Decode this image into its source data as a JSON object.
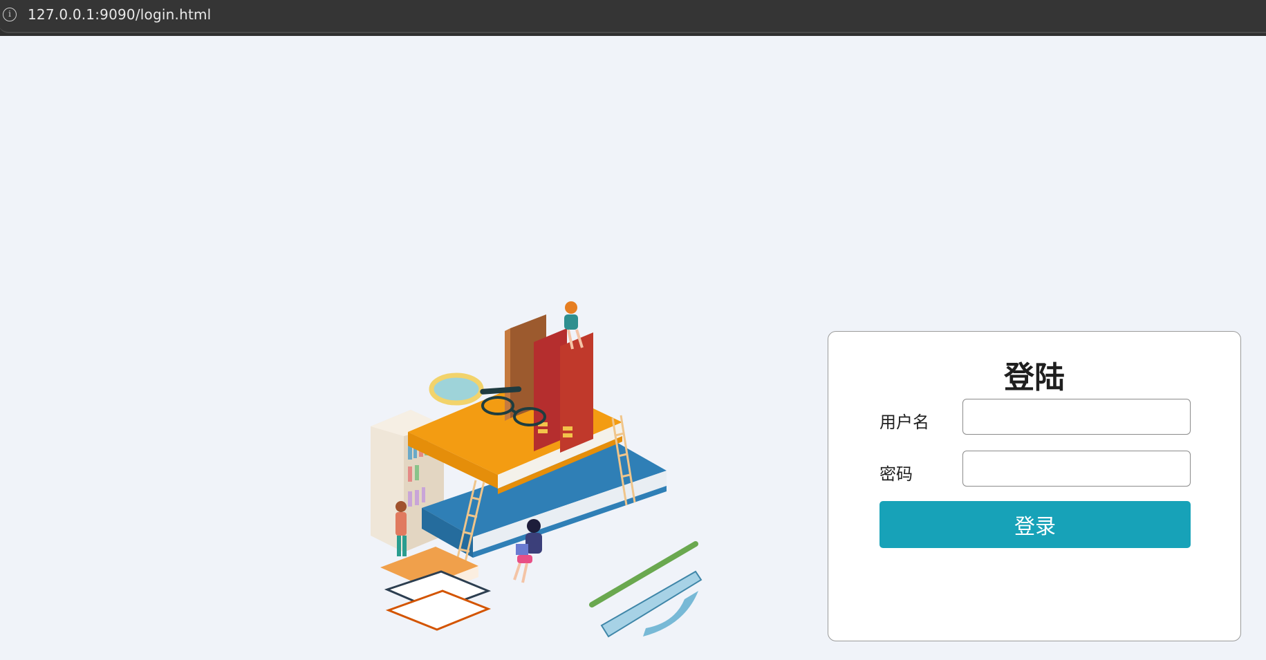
{
  "browser": {
    "url": "127.0.0.1:9090/login.html",
    "info_icon": "info-icon"
  },
  "login": {
    "title": "登陆",
    "username_label": "用户名",
    "username_value": "",
    "password_label": "密码",
    "password_value": "",
    "submit_label": "登录",
    "submit_color": "#17a2b8"
  },
  "illustration": {
    "name": "isometric-library-books-illustration"
  },
  "colors": {
    "background": "#f0f3f9",
    "card": "#ffffff"
  }
}
